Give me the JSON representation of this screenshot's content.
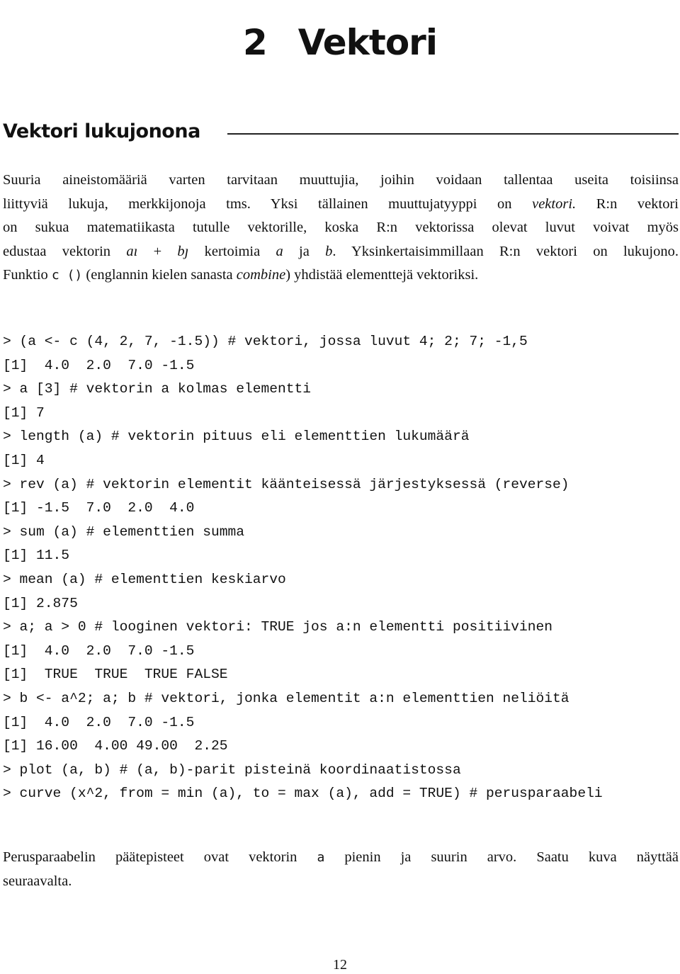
{
  "chapter": {
    "number": "2",
    "title": "Vektori"
  },
  "section": {
    "title": "Vektori lukujonona"
  },
  "intro": {
    "lines": [
      {
        "segments": [
          {
            "t": "text",
            "v": "Suuria aineistomääriä varten tarvitaan muuttujia, joihin voidaan tallentaa useita toisiinsa"
          }
        ]
      },
      {
        "segments": [
          {
            "t": "text",
            "v": "liittyviä lukuja, merkkijonoja tms. Yksi tällainen muuttujatyyppi on "
          },
          {
            "t": "em",
            "v": "vektori."
          },
          {
            "t": "text",
            "v": " R:n vektori"
          }
        ]
      },
      {
        "segments": [
          {
            "t": "text",
            "v": "on sukua matematiikasta tutulle vektorille, koska R:n vektorissa olevat luvut voivat myös"
          }
        ]
      },
      {
        "segments": [
          {
            "t": "text",
            "v": "edustaa vektorin "
          },
          {
            "t": "math",
            "v": "a"
          },
          {
            "t": "mathbar",
            "v": "ı"
          },
          {
            "t": "text",
            "v": " + "
          },
          {
            "t": "math",
            "v": "b"
          },
          {
            "t": "mathbar",
            "v": "ȷ"
          },
          {
            "t": "text",
            "v": " kertoimia "
          },
          {
            "t": "math",
            "v": "a"
          },
          {
            "t": "text",
            "v": " ja "
          },
          {
            "t": "math",
            "v": "b"
          },
          {
            "t": "text",
            "v": ". Yksinkertaisimmillaan R:n vektori on lukujono."
          }
        ]
      },
      {
        "segments": [
          {
            "t": "text",
            "v": "Funktio "
          },
          {
            "t": "code",
            "v": "c ()"
          },
          {
            "t": "text",
            "v": " (englannin kielen sanasta "
          },
          {
            "t": "em",
            "v": "combine"
          },
          {
            "t": "text",
            "v": ") yhdistää elementtejä vektoriksi."
          }
        ]
      }
    ]
  },
  "code": {
    "lines": [
      "> (a <- c (4, 2, 7, -1.5)) # vektori, jossa luvut 4; 2; 7; -1,5",
      "[1]  4.0  2.0  7.0 -1.5",
      "> a [3] # vektorin a kolmas elementti",
      "[1] 7",
      "> length (a) # vektorin pituus eli elementtien lukumäärä",
      "[1] 4",
      "> rev (a) # vektorin elementit käänteisessä järjestyksessä (reverse)",
      "[1] -1.5  7.0  2.0  4.0",
      "> sum (a) # elementtien summa",
      "[1] 11.5",
      "> mean (a) # elementtien keskiarvo",
      "[1] 2.875",
      "> a; a > 0 # looginen vektori: TRUE jos a:n elementti positiivinen",
      "[1]  4.0  2.0  7.0 -1.5",
      "[1]  TRUE  TRUE  TRUE FALSE",
      "> b <- a^2; a; b # vektori, jonka elementit a:n elementtien neliöitä",
      "[1]  4.0  2.0  7.0 -1.5",
      "[1] 16.00  4.00 49.00  2.25",
      "> plot (a, b) # (a, b)-parit pisteinä koordinaatistossa",
      "> curve (x^2, from = min (a), to = max (a), add = TRUE) # perusparaabeli"
    ]
  },
  "outro": {
    "lines": [
      {
        "segments": [
          {
            "t": "text",
            "v": "Perusparaabelin päätepisteet ovat vektorin "
          },
          {
            "t": "code",
            "v": "a"
          },
          {
            "t": "text",
            "v": " pienin ja suurin arvo. Saatu kuva näyttää"
          }
        ]
      },
      {
        "segments": [
          {
            "t": "text",
            "v": "seuraavalta."
          }
        ]
      }
    ]
  },
  "page_number": "12"
}
